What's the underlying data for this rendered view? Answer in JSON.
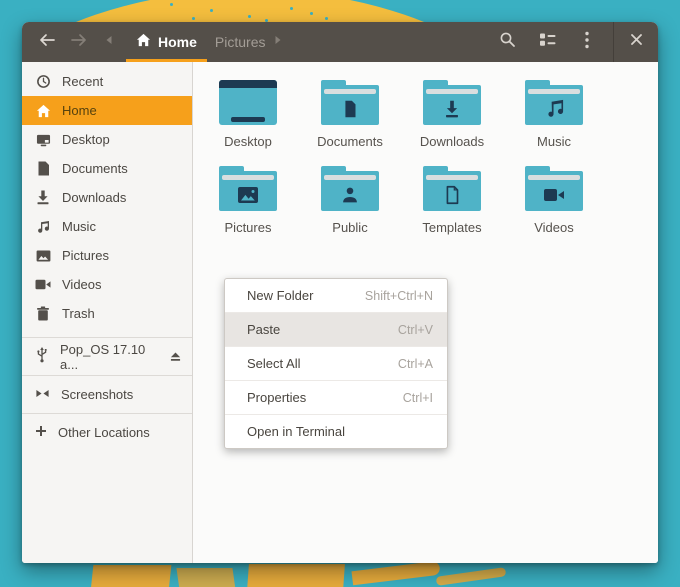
{
  "colors": {
    "desktop_teal": "#3AB0C2",
    "artwork_yellow": "#F4BE3E",
    "accent_orange": "#F6A01B",
    "headerbar_bg": "#544F49",
    "folder_teal": "#4FB3C7",
    "glyph_navy": "#1D3A52"
  },
  "header": {
    "breadcrumb_home": "Home",
    "breadcrumb_current": "Pictures"
  },
  "sidebar": {
    "items": [
      {
        "label": "Recent"
      },
      {
        "label": "Home",
        "selected": true
      },
      {
        "label": "Desktop"
      },
      {
        "label": "Documents"
      },
      {
        "label": "Downloads"
      },
      {
        "label": "Music"
      },
      {
        "label": "Pictures"
      },
      {
        "label": "Videos"
      },
      {
        "label": "Trash"
      }
    ],
    "device": {
      "label": "Pop_OS 17.10 a..."
    },
    "bookmark": {
      "label": "Screenshots"
    },
    "other_locations": {
      "label": "Other Locations"
    }
  },
  "files": {
    "folders": [
      {
        "name": "Desktop"
      },
      {
        "name": "Documents"
      },
      {
        "name": "Downloads"
      },
      {
        "name": "Music"
      },
      {
        "name": "Pictures"
      },
      {
        "name": "Public"
      },
      {
        "name": "Templates"
      },
      {
        "name": "Videos"
      }
    ]
  },
  "context_menu": {
    "highlighted": "Paste",
    "items": [
      {
        "label": "New Folder",
        "shortcut": "Shift+Ctrl+N"
      },
      {
        "label": "Paste",
        "shortcut": "Ctrl+V"
      },
      {
        "label": "Select All",
        "shortcut": "Ctrl+A"
      },
      {
        "label": "Properties",
        "shortcut": "Ctrl+I"
      },
      {
        "label": "Open in Terminal",
        "shortcut": ""
      }
    ]
  }
}
